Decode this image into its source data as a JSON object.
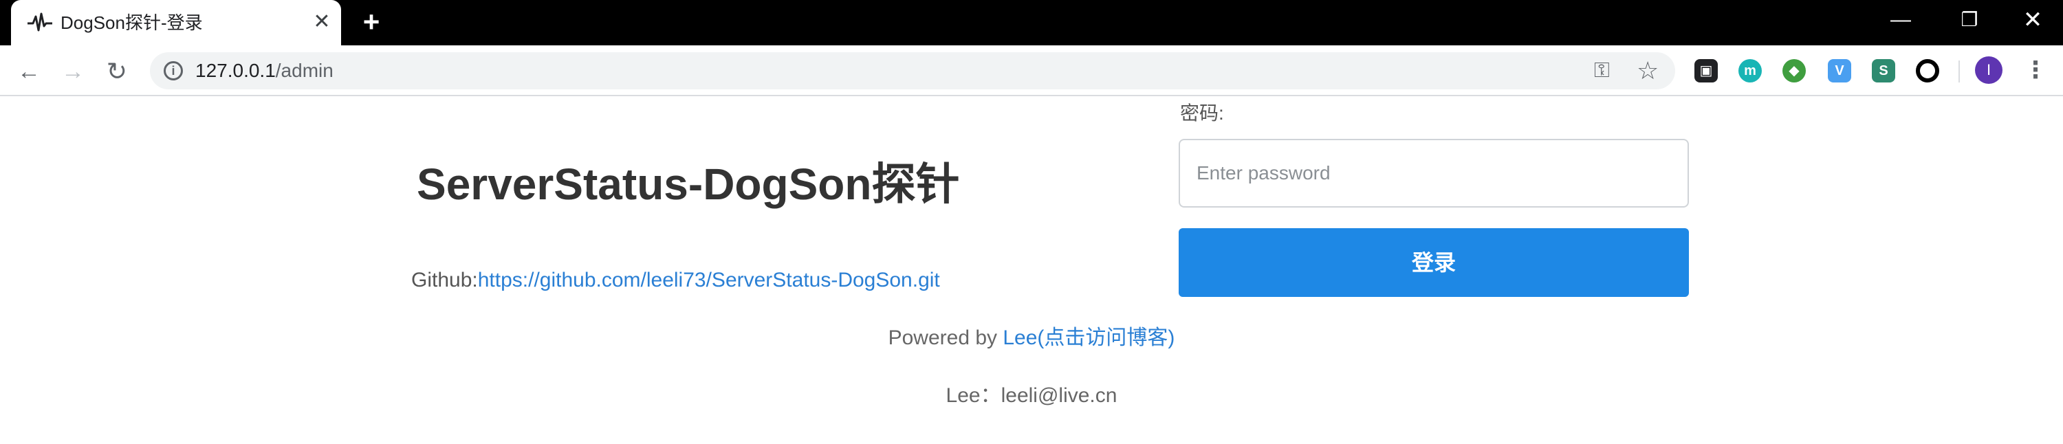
{
  "browser": {
    "tab": {
      "title": "DogSon探针-登录",
      "favicon": "heartbeat-icon",
      "close_glyph": "✕"
    },
    "new_tab_glyph": "+",
    "window_controls": {
      "minimize": "—",
      "restore": "❐",
      "close": "✕"
    },
    "nav": {
      "back": "←",
      "forward": "→",
      "reload": "↻"
    },
    "address": {
      "host": "127.0.0.1",
      "path": "/admin"
    },
    "extensions": [
      {
        "name": "extension-1-icon",
        "glyph": "▣"
      },
      {
        "name": "extension-2-icon",
        "glyph": "m"
      },
      {
        "name": "extension-3-icon",
        "glyph": "◆"
      },
      {
        "name": "extension-4-icon",
        "glyph": "V"
      },
      {
        "name": "extension-5-icon",
        "glyph": "S"
      },
      {
        "name": "extension-6-icon",
        "glyph": ""
      }
    ],
    "profile_initial": "I",
    "menu_glyph": "⋮"
  },
  "page": {
    "title": "ServerStatus-DogSon探针",
    "github_prefix": "Github:",
    "github_url": "https://github.com/leeli73/ServerStatus-DogSon.git",
    "password_label": "密码:",
    "password_placeholder": "Enter password",
    "login_button": "登录",
    "powered_prefix": "Powered by ",
    "powered_link": "Lee(点击访问博客)",
    "contact_name": "Lee",
    "contact_sep": "：",
    "contact_email": "leeli@live.cn"
  },
  "colors": {
    "accent": "#1e88e5",
    "link": "#2a7fd4",
    "avatar": "#5e35b1"
  }
}
